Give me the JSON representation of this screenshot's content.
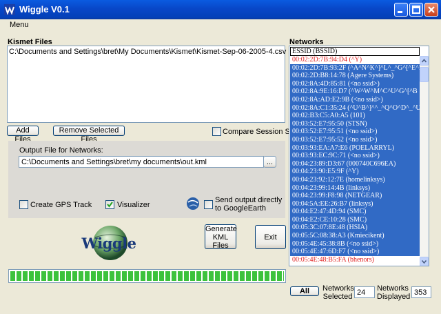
{
  "window": {
    "title": "Wiggle V0.1"
  },
  "menu": {
    "items": [
      "Menu"
    ]
  },
  "kismet_files": {
    "label": "Kismet Files",
    "files": [
      "C:\\Documents and Settings\\bret\\My Documents\\Kismet\\Kismet-Sep-06-2005-4.csv"
    ],
    "add_label": "Add Files",
    "remove_label": "Remove Selected Files",
    "compare_label": "Compare Session Sets",
    "compare_checked": false
  },
  "output": {
    "label": "Output File for Networks:",
    "path": "C:\\Documents and Settings\\bret\\my documents\\out.kml",
    "browse_label": "...",
    "gps_label": "Create GPS Track",
    "gps_checked": false,
    "visualizer_label": "Visualizer",
    "visualizer_checked": true,
    "ge_label_1": "Send output directly",
    "ge_label_2": "to GoogleEarth",
    "ge_checked": false
  },
  "actions": {
    "generate_line1": "Generate",
    "generate_line2": "KML Files",
    "exit_label": "Exit"
  },
  "logo": {
    "text": "Wiggle"
  },
  "progress": {
    "value": 1.0
  },
  "networks": {
    "label": "Networks",
    "header": "ESSID  (BSSID)",
    "rows": [
      "00:02:2D:7B:94:D4 (^Y)",
      "00:02:2D:7B:93:2F (^A^N^K^]^L^_^G^[^E^P^",
      "00:02:2D:B8:14:78 (Agere Systems)",
      "00:02:8A:4D:85:81 (<no ssid>)",
      "00:02:8A:9E:16:D7 (^W^W^M^C^U^G^[^B",
      "00:02:8A:AD:E2:9B (<no ssid>)",
      "00:02:8A:C1:35:24 (^U^B^]^^_^Q^O^D^_^U",
      "00:02:B3:C5:A0:A5 (101)",
      "00:03:52:E7:95:50 (STSN)",
      "00:03:52:E7:95:51 (<no ssid>)",
      "00:03:52:E7:95:52 (<no ssid>)",
      "00:03:93:EA:A7:E6 (POELARRYL)",
      "00:03:93:EC:9C:71 (<no ssid>)",
      "00:04:23:89:D3:67 (000740C696EA)",
      "00:04:23:90:E5:9F (^Y)",
      "00:04:23:92:12:7E (homelinksys)",
      "00:04:23:99:14:4B (linksys)",
      "00:04:23:99:F8:98 (NETGEAR)",
      "00:04:5A:EE:26:B7 (linksys)",
      "00:04:E2:47:4D:94 (SMC)",
      "00:04:E2:CE:10:28 (SMC)",
      "00:05:3C:07:8E:48 (HSIA)",
      "00:05:5C:08:38:A3 (Kmiecikent)",
      "00:05:4E:45:38:8B (<no ssid>)",
      "00:05:4E:47:6D:F7 (<no ssid>)",
      "00:05:4E:48:B5:FA (bhenors)"
    ],
    "all_label": "All",
    "selected_label_1": "Networks",
    "selected_label_2": "Selected",
    "selected_value": "24",
    "displayed_label_1": "Networks",
    "displayed_label_2": "Displayed",
    "displayed_value": "353"
  },
  "colors": {
    "selection": "#316AC5",
    "unselected_text": "#E02020",
    "progress": "#3CC23C"
  }
}
